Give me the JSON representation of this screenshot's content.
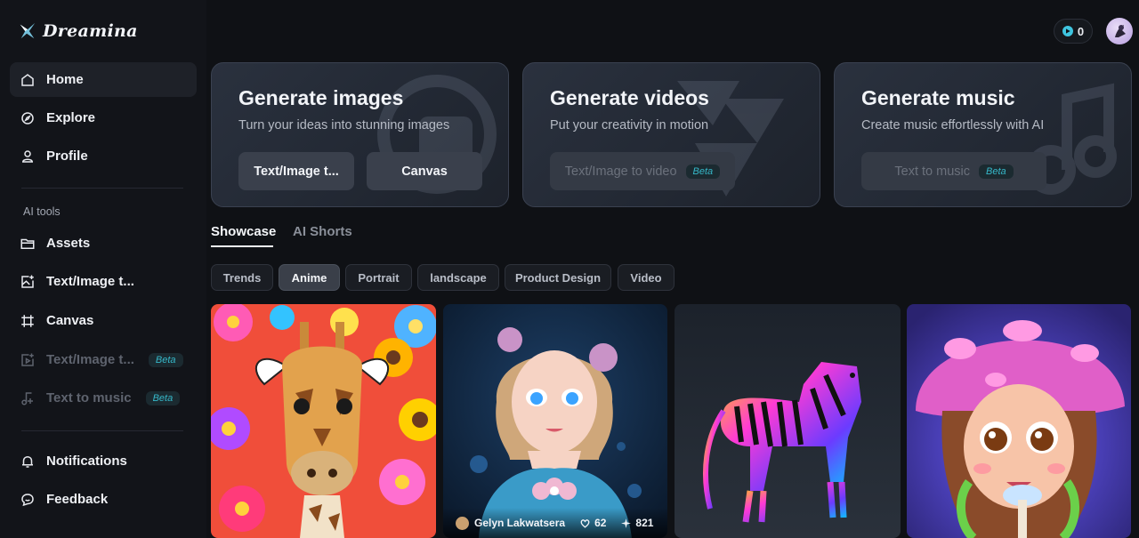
{
  "app": {
    "logo_text": "Dreamina",
    "credits": "0"
  },
  "sidebar": {
    "top_items": [
      {
        "label": "Home",
        "icon": "home-icon",
        "active": true
      },
      {
        "label": "Explore",
        "icon": "compass-icon"
      },
      {
        "label": "Profile",
        "icon": "user-icon"
      }
    ],
    "section_label": "AI tools",
    "tool_items": [
      {
        "label": "Assets",
        "icon": "folder-icon"
      },
      {
        "label": "Text/Image t...",
        "icon": "image-edit-icon"
      },
      {
        "label": "Canvas",
        "icon": "canvas-icon"
      },
      {
        "label": "Text/Image t...",
        "icon": "video-icon",
        "badge": "Beta",
        "disabled": true
      },
      {
        "label": "Text to music",
        "icon": "music-icon",
        "badge": "Beta",
        "disabled": true
      }
    ],
    "bottom_items": [
      {
        "label": "Notifications",
        "icon": "bell-icon"
      },
      {
        "label": "Feedback",
        "icon": "feedback-icon"
      }
    ]
  },
  "cards": [
    {
      "title": "Generate images",
      "subtitle": "Turn your ideas into stunning images",
      "buttons": [
        {
          "label": "Text/Image t..."
        },
        {
          "label": "Canvas"
        }
      ]
    },
    {
      "title": "Generate videos",
      "subtitle": "Put your creativity in motion",
      "buttons": [
        {
          "label": "Text/Image to video",
          "badge": "Beta",
          "disabled": true
        }
      ]
    },
    {
      "title": "Generate music",
      "subtitle": "Create music effortlessly with AI",
      "buttons": [
        {
          "label": "Text to music",
          "badge": "Beta",
          "disabled": true
        }
      ]
    }
  ],
  "tabs": [
    {
      "label": "Showcase",
      "active": true
    },
    {
      "label": "AI Shorts"
    }
  ],
  "chips": [
    {
      "label": "Trends"
    },
    {
      "label": "Anime",
      "active": true
    },
    {
      "label": "Portrait"
    },
    {
      "label": "landscape"
    },
    {
      "label": "Product Design"
    },
    {
      "label": "Video"
    }
  ],
  "gallery": [
    {
      "subject": "giraffe-with-flowers"
    },
    {
      "subject": "doll-portrait",
      "author": "Gelyn Lakwatsera",
      "likes": "62",
      "remixes": "821"
    },
    {
      "subject": "neon-zebra"
    },
    {
      "subject": "mushroom-girl"
    }
  ],
  "colors": {
    "background": "#0f1115",
    "sidebar": "#121419",
    "accent": "#36b8c9",
    "card_border": "#3a4150"
  }
}
